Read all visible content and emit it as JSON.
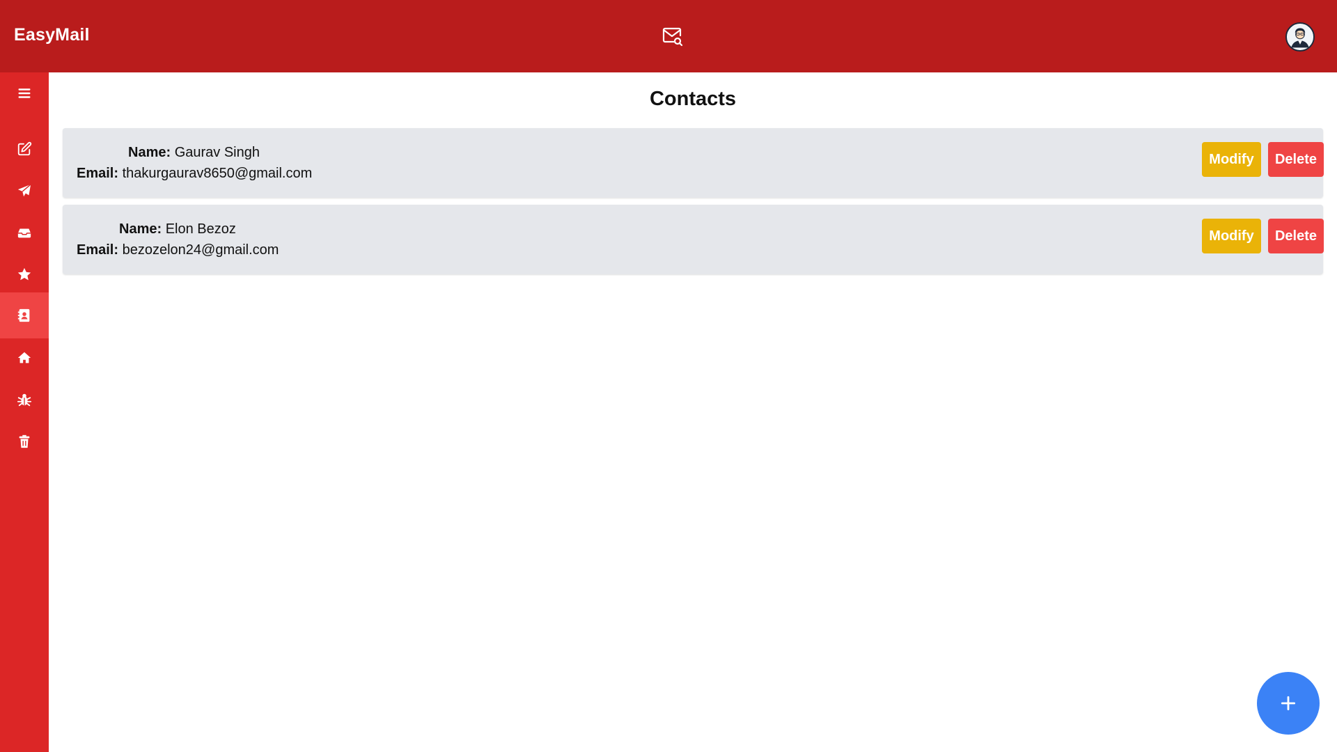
{
  "app": {
    "title": "EasyMail"
  },
  "header": {
    "center_icon": "mail-search-icon",
    "avatar_icon": "user-avatar-icon"
  },
  "sidebar": {
    "items": [
      {
        "icon": "menu-icon"
      },
      {
        "icon": "compose-icon"
      },
      {
        "icon": "sent-icon"
      },
      {
        "icon": "inbox-icon"
      },
      {
        "icon": "starred-icon"
      },
      {
        "icon": "contacts-icon",
        "active": true
      },
      {
        "icon": "home-icon"
      },
      {
        "icon": "spam-icon"
      },
      {
        "icon": "trash-icon"
      }
    ]
  },
  "main": {
    "title": "Contacts",
    "contacts": [
      {
        "name_label": "Name:",
        "name": "Gaurav Singh",
        "email_label": "Email:",
        "email": "thakurgaurav8650@gmail.com",
        "modify_label": "Modify",
        "delete_label": "Delete"
      },
      {
        "name_label": "Name:",
        "name": "Elon Bezoz",
        "email_label": "Email:",
        "email": "bezozelon24@gmail.com",
        "modify_label": "Modify",
        "delete_label": "Delete"
      }
    ]
  },
  "fab": {
    "icon": "plus-icon"
  },
  "colors": {
    "header": "#b91c1c",
    "sidebar": "#dc2626",
    "sidebar_active": "#ef4444",
    "card": "#e5e7eb",
    "modify": "#eab308",
    "delete": "#ef4444",
    "fab": "#3b82f6"
  }
}
